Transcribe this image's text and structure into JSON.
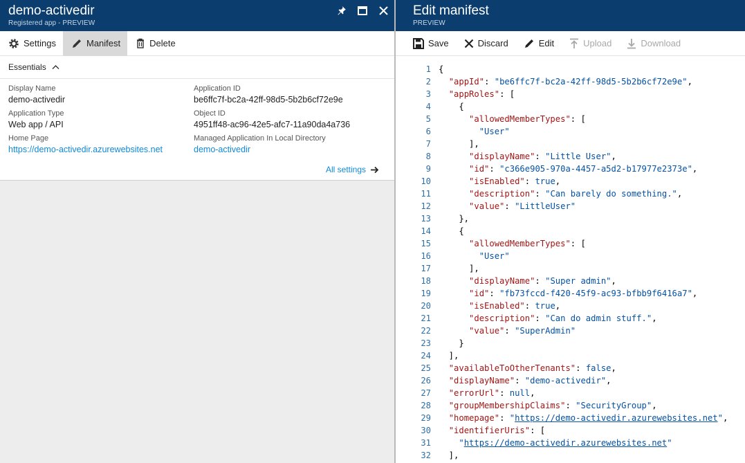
{
  "left": {
    "title": "demo-activedir",
    "subtitle": "Registered app - PREVIEW",
    "commands": [
      {
        "label": "Settings"
      },
      {
        "label": "Manifest"
      },
      {
        "label": "Delete"
      }
    ],
    "essentials_label": "Essentials",
    "properties": {
      "display_name_label": "Display Name",
      "display_name": "demo-activedir",
      "app_type_label": "Application Type",
      "app_type": "Web app / API",
      "home_page_label": "Home Page",
      "home_page": "https://demo-activedir.azurewebsites.net",
      "app_id_label": "Application ID",
      "app_id": "be6ffc7f-bc2a-42ff-98d5-5b2b6cf72e9e",
      "object_id_label": "Object ID",
      "object_id": "4951ff48-ac96-42e5-afc7-11a90da4a736",
      "managed_app_label": "Managed Application In Local Directory",
      "managed_app": "demo-activedir"
    },
    "all_settings": "All settings"
  },
  "right": {
    "title": "Edit manifest",
    "subtitle": "PREVIEW",
    "commands": [
      {
        "label": "Save"
      },
      {
        "label": "Discard"
      },
      {
        "label": "Edit"
      },
      {
        "label": "Upload"
      },
      {
        "label": "Download"
      }
    ]
  },
  "manifest_lines": [
    {
      "n": "1",
      "code": "{"
    },
    {
      "n": "2",
      "code": "  \"appId\": \"be6ffc7f-bc2a-42ff-98d5-5b2b6cf72e9e\","
    },
    {
      "n": "3",
      "code": "  \"appRoles\": ["
    },
    {
      "n": "4",
      "code": "    {"
    },
    {
      "n": "5",
      "code": "      \"allowedMemberTypes\": ["
    },
    {
      "n": "6",
      "code": "        \"User\""
    },
    {
      "n": "7",
      "code": "      ],"
    },
    {
      "n": "8",
      "code": "      \"displayName\": \"Little User\","
    },
    {
      "n": "9",
      "code": "      \"id\": \"c366e905-970a-4457-a5d2-b17977e2373e\","
    },
    {
      "n": "10",
      "code": "      \"isEnabled\": true,"
    },
    {
      "n": "11",
      "code": "      \"description\": \"Can barely do something.\","
    },
    {
      "n": "12",
      "code": "      \"value\": \"LittleUser\""
    },
    {
      "n": "13",
      "code": "    },"
    },
    {
      "n": "14",
      "code": "    {"
    },
    {
      "n": "15",
      "code": "      \"allowedMemberTypes\": ["
    },
    {
      "n": "16",
      "code": "        \"User\""
    },
    {
      "n": "17",
      "code": "      ],"
    },
    {
      "n": "18",
      "code": "      \"displayName\": \"Super admin\","
    },
    {
      "n": "19",
      "code": "      \"id\": \"fb73fccd-f420-45f9-ac93-bfbb9f6416a7\","
    },
    {
      "n": "20",
      "code": "      \"isEnabled\": true,"
    },
    {
      "n": "21",
      "code": "      \"description\": \"Can do admin stuff.\","
    },
    {
      "n": "22",
      "code": "      \"value\": \"SuperAdmin\""
    },
    {
      "n": "23",
      "code": "    }"
    },
    {
      "n": "24",
      "code": "  ],"
    },
    {
      "n": "25",
      "code": "  \"availableToOtherTenants\": false,"
    },
    {
      "n": "26",
      "code": "  \"displayName\": \"demo-activedir\","
    },
    {
      "n": "27",
      "code": "  \"errorUrl\": null,"
    },
    {
      "n": "28",
      "code": "  \"groupMembershipClaims\": \"SecurityGroup\","
    },
    {
      "n": "29",
      "code": "  \"homepage\": \"https://demo-activedir.azurewebsites.net\","
    },
    {
      "n": "30",
      "code": "  \"identifierUris\": ["
    },
    {
      "n": "31",
      "code": "    \"https://demo-activedir.azurewebsites.net\""
    },
    {
      "n": "32",
      "code": "  ],"
    }
  ]
}
